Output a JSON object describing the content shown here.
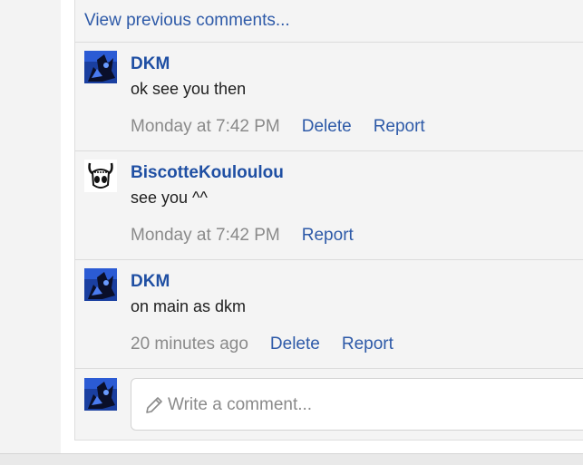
{
  "comments_section": {
    "view_previous": "View previous comments...",
    "items": [
      {
        "author": "DKM",
        "text": "ok see you then",
        "time": "Monday at 7:42 PM",
        "actions": [
          "Delete",
          "Report"
        ],
        "avatar": "dark-blue-character-avatar"
      },
      {
        "author": "BiscotteKouloulou",
        "text": "see you ^^",
        "time": "Monday at 7:42 PM",
        "actions": [
          "Report"
        ],
        "avatar": "horned-mask-avatar"
      },
      {
        "author": "DKM",
        "text": "on main as dkm",
        "time": "20 minutes ago",
        "actions": [
          "Delete",
          "Report"
        ],
        "avatar": "dark-blue-character-avatar"
      }
    ],
    "composer": {
      "placeholder": "Write a comment...",
      "avatar": "dark-blue-character-avatar",
      "icon": "pencil-icon"
    }
  },
  "colors": {
    "link": "#2e5aa8",
    "author": "#1f4fa3",
    "muted": "#8a8a8a",
    "panel": "#f4f4f4"
  }
}
